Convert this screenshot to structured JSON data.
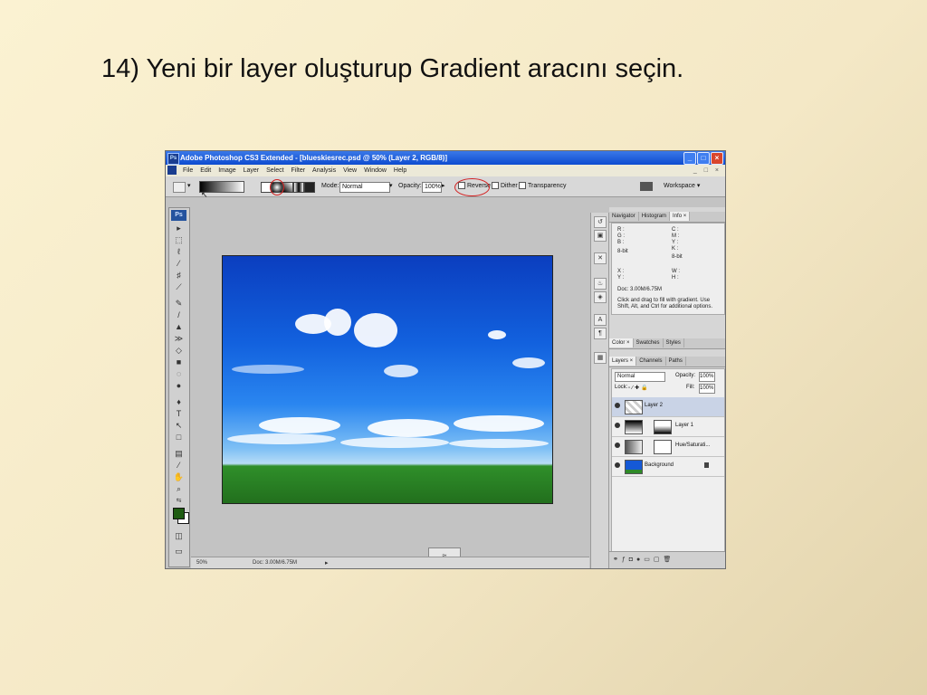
{
  "slide": {
    "title": "14) Yeni bir layer oluşturup Gradient aracını seçin."
  },
  "window": {
    "title": "Adobe Photoshop CS3 Extended - [blueskiesrec.psd @ 50% (Layer 2, RGB/8)]",
    "buttons": {
      "minimize": "_",
      "maximize": "□",
      "close": "×"
    }
  },
  "menubar": {
    "items": [
      "File",
      "Edit",
      "Image",
      "Layer",
      "Select",
      "Filter",
      "Analysis",
      "View",
      "Window",
      "Help"
    ],
    "controls": "_ □ ×"
  },
  "options_bar": {
    "mode_label": "Mode:",
    "mode_value": "Normal",
    "opacity_label": "Opacity:",
    "opacity_value": "100%",
    "reverse_label": "Reverse",
    "dither_label": "Dither",
    "transparency_label": "Transparency",
    "workspace_label": "Workspace ▾",
    "checkboxes": {
      "reverse": true,
      "dither": true,
      "transparency": true
    }
  },
  "toolbox": {
    "badge": "Ps",
    "tools": [
      "move-tool",
      "marquee-tool",
      "lasso-tool",
      "magic-wand-tool",
      "crop-tool",
      "slice-tool",
      "healing-brush-tool",
      "brush-tool",
      "clone-stamp-tool",
      "history-brush-tool",
      "eraser-tool",
      "gradient-tool",
      "blur-tool",
      "dodge-tool",
      "pen-tool",
      "type-tool",
      "path-selection-tool",
      "shape-tool",
      "notes-tool",
      "eyedropper-tool",
      "hand-tool",
      "zoom-tool"
    ],
    "foreground_color": "#1f5c13",
    "background_color": "#ffffff"
  },
  "statusbar": {
    "zoom": "50%",
    "doc": "Doc: 3.00M/6.75M"
  },
  "panels": {
    "top_tabs": [
      "Navigator",
      "Histogram",
      "Info ×"
    ],
    "info": {
      "rgb": "R :\nG :\nB :",
      "cmyk": "C :\nM :\nY :\nK :",
      "bits_left": "8-bit",
      "bits_right": "8-bit",
      "xy": "X :\nY :",
      "wh": "W :\nH :",
      "doc": "Doc: 3.00M/6.75M",
      "hint": "Click and drag to fill with gradient. Use Shift, Alt, and Ctrl for additional options."
    },
    "mid_tabs": [
      "Color ×",
      "Swatches",
      "Styles"
    ],
    "layers_tabs": [
      "Layers ×",
      "Channels",
      "Paths"
    ],
    "layers_mode": "Normal",
    "layers_opacity_label": "Opacity:",
    "layers_opacity_value": "100%",
    "lock_label": "Lock:",
    "fill_label": "Fill:",
    "fill_value": "100%",
    "layers": [
      {
        "name": "Layer 2",
        "selected": true
      },
      {
        "name": "Layer 1",
        "selected": false
      },
      {
        "name": "Hue/Saturati...",
        "selected": false
      },
      {
        "name": "Background",
        "selected": false
      }
    ]
  },
  "colors": {
    "accent_red": "#d21f1f",
    "titlebar_blue": "#0d4bd0"
  }
}
